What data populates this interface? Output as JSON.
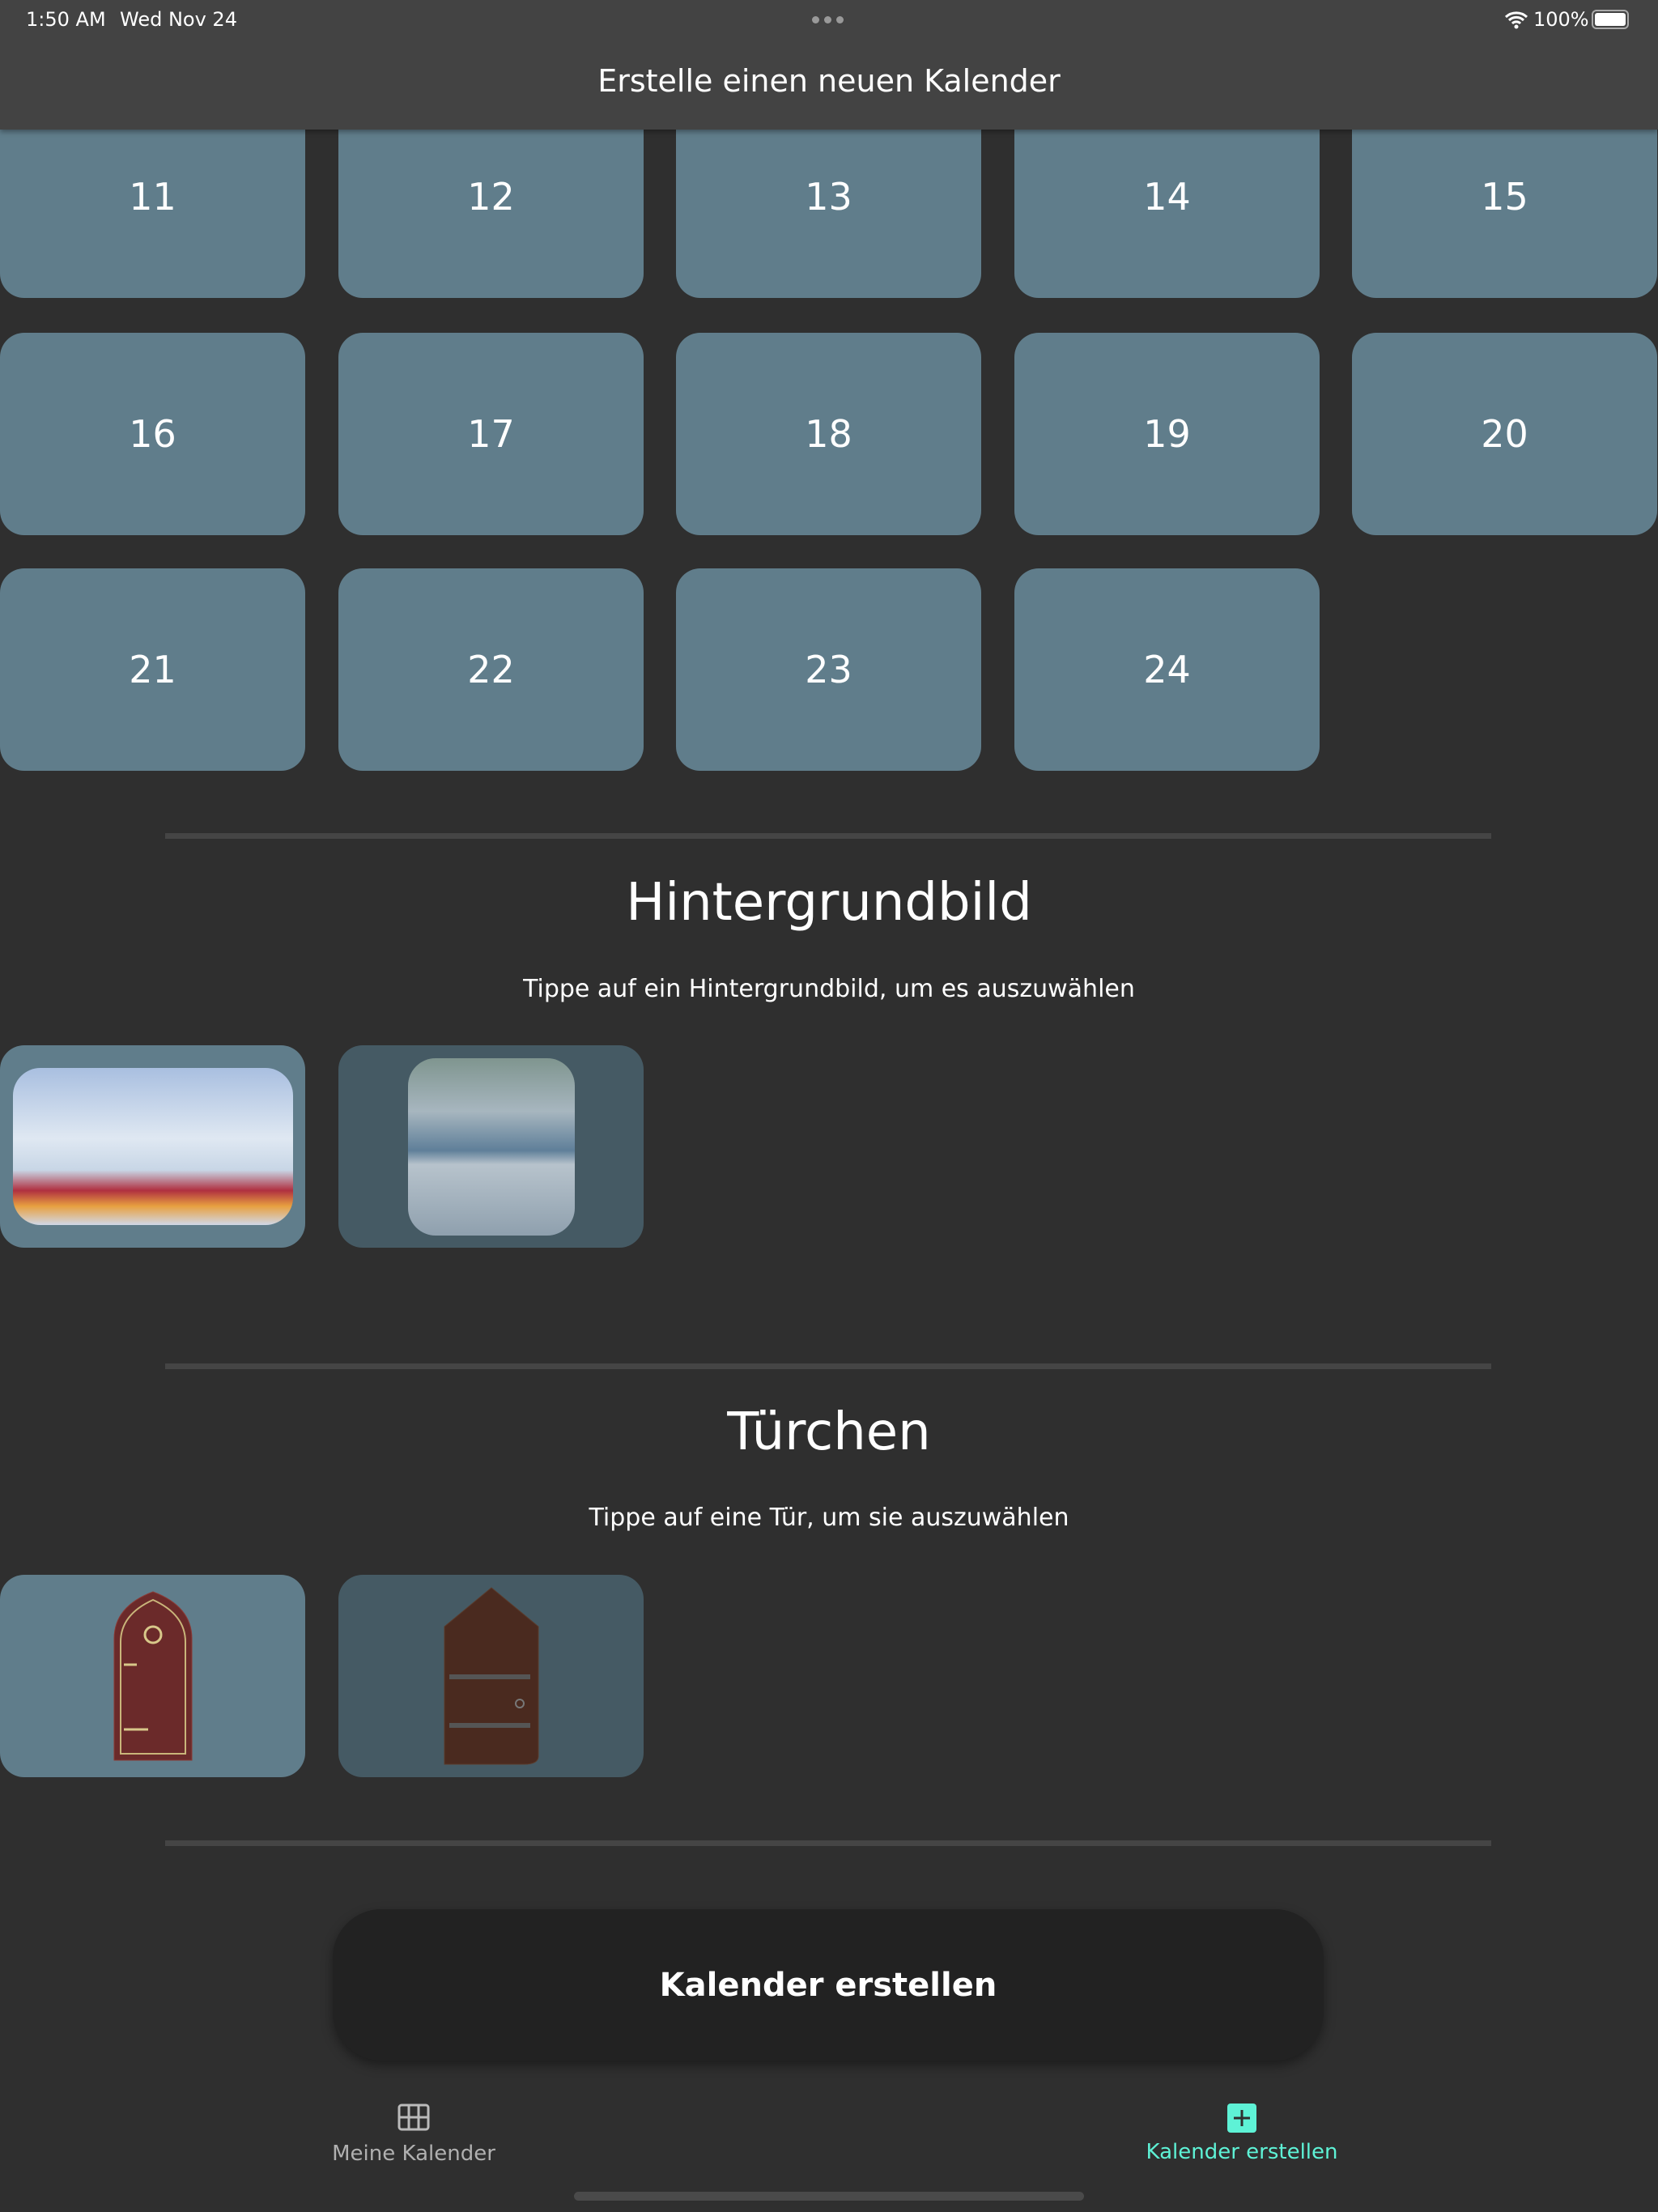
{
  "status_bar": {
    "time": "1:50 AM",
    "date": "Wed Nov 24",
    "battery": "100%"
  },
  "header": {
    "title": "Erstelle einen neuen Kalender"
  },
  "days": [
    "11",
    "12",
    "13",
    "14",
    "15",
    "16",
    "17",
    "18",
    "19",
    "20",
    "21",
    "22",
    "23",
    "24"
  ],
  "background_section": {
    "title": "Hintergrundbild",
    "hint": "Tippe auf ein Hintergrundbild, um es auszuwählen",
    "selected_index": 0
  },
  "door_section": {
    "title": "Türchen",
    "hint": "Tippe auf eine Tür, um sie auszuwählen",
    "selected_index": 0
  },
  "create_button": {
    "label": "Kalender erstellen"
  },
  "tabs": [
    {
      "label": "Meine Kalender",
      "icon": "grid-icon",
      "active": false
    },
    {
      "label": "Kalender erstellen",
      "icon": "plus-square-icon",
      "active": true
    }
  ],
  "colors": {
    "tile": "#607d8b",
    "tile_unselected": "#455a64",
    "accent": "#5ef2d6",
    "header": "#434343",
    "background": "#2f2f2f"
  }
}
